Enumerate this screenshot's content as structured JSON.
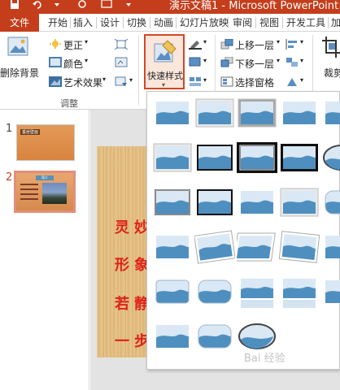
{
  "window": {
    "title": "演示文稿1 - Microsoft PowerPoint"
  },
  "tabs": [
    {
      "key": "file",
      "label": "文件"
    },
    {
      "key": "home",
      "label": "开始"
    },
    {
      "key": "insert",
      "label": "插入"
    },
    {
      "key": "design",
      "label": "设计"
    },
    {
      "key": "transitions",
      "label": "切换"
    },
    {
      "key": "animations",
      "label": "动画"
    },
    {
      "key": "slideshow",
      "label": "幻灯片放映"
    },
    {
      "key": "review",
      "label": "审阅"
    },
    {
      "key": "view",
      "label": "视图"
    },
    {
      "key": "developer",
      "label": "开发工具"
    },
    {
      "key": "addins",
      "label": "加"
    }
  ],
  "ribbon": {
    "remove_background": "删除背景",
    "corrections": "更正",
    "color": "颜色",
    "artistic_effects": "艺术效果",
    "adjust_group": "调整",
    "quick_styles": "快速样式",
    "bring_forward": "上移一层",
    "send_backward": "下移一层",
    "selection_pane": "选择窗格",
    "crop": "裁剪"
  },
  "slides_panel": {
    "slide1": {
      "number": "1",
      "title": "垂崖壁画"
    },
    "slide2": {
      "number": "2",
      "title": "简介"
    }
  },
  "slide": {
    "lines": [
      "灵妙",
      "形象",
      "若静",
      "一步"
    ]
  },
  "gallery": {
    "rows": 6,
    "cols": 5,
    "item_count": 28,
    "accent": "#4f8fc0"
  },
  "watermark": "Bai 经验"
}
